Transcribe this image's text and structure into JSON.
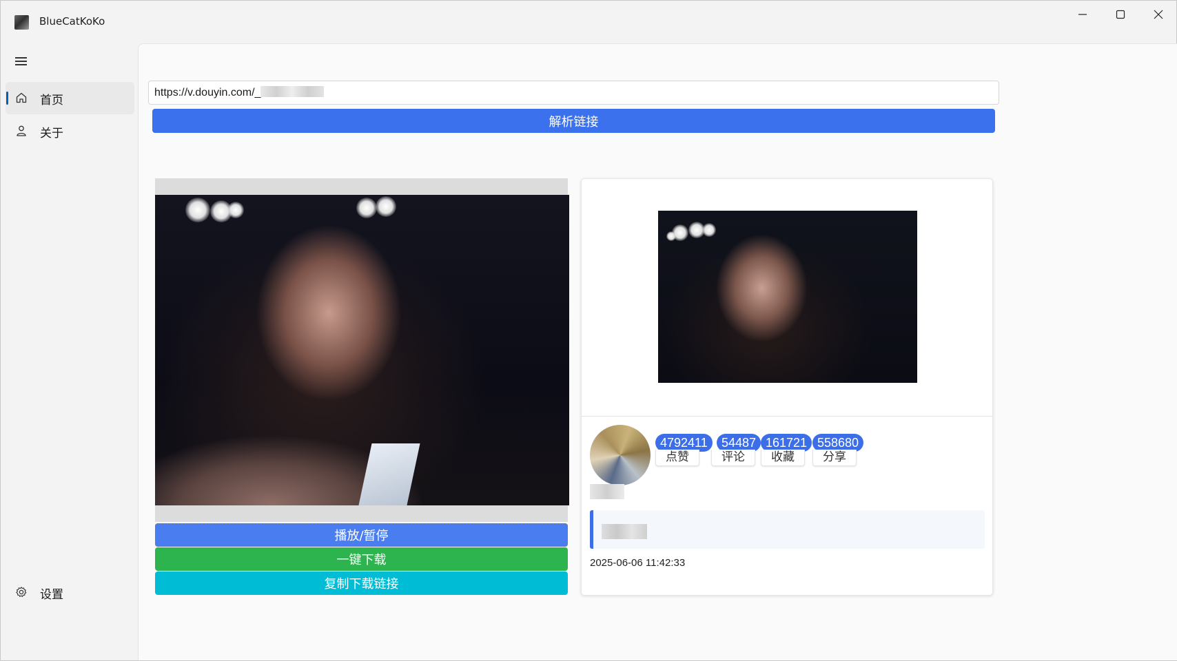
{
  "window": {
    "title": "BlueCatKoKo",
    "controls": [
      "minimize-icon",
      "maximize-icon",
      "close-icon"
    ]
  },
  "sidebar": {
    "menu_icon": "hamburger-icon",
    "items": [
      {
        "label": "首页",
        "icon": "home-icon",
        "active": true
      },
      {
        "label": "关于",
        "icon": "person-icon",
        "active": false
      }
    ],
    "footer": {
      "label": "设置",
      "icon": "gear-icon"
    }
  },
  "main": {
    "url_input": {
      "value": "https://v.douyin.com/_"
    },
    "parse_button": "解析链接",
    "video_buttons": {
      "play_pause": "播放/暂停",
      "download": "一键下载",
      "copy_link": "复制下载链接"
    },
    "info": {
      "stats": [
        {
          "count": "4792411",
          "label": "点赞"
        },
        {
          "count": "54487",
          "label": "评论"
        },
        {
          "count": "161721",
          "label": "收藏"
        },
        {
          "count": "558680",
          "label": "分享"
        }
      ],
      "date": "2025-06-06 11:42:33"
    }
  },
  "colors": {
    "accent": "#3c71ed",
    "download": "#2db44e",
    "copy": "#00bcd4",
    "nav_indicator": "#005fb8"
  }
}
